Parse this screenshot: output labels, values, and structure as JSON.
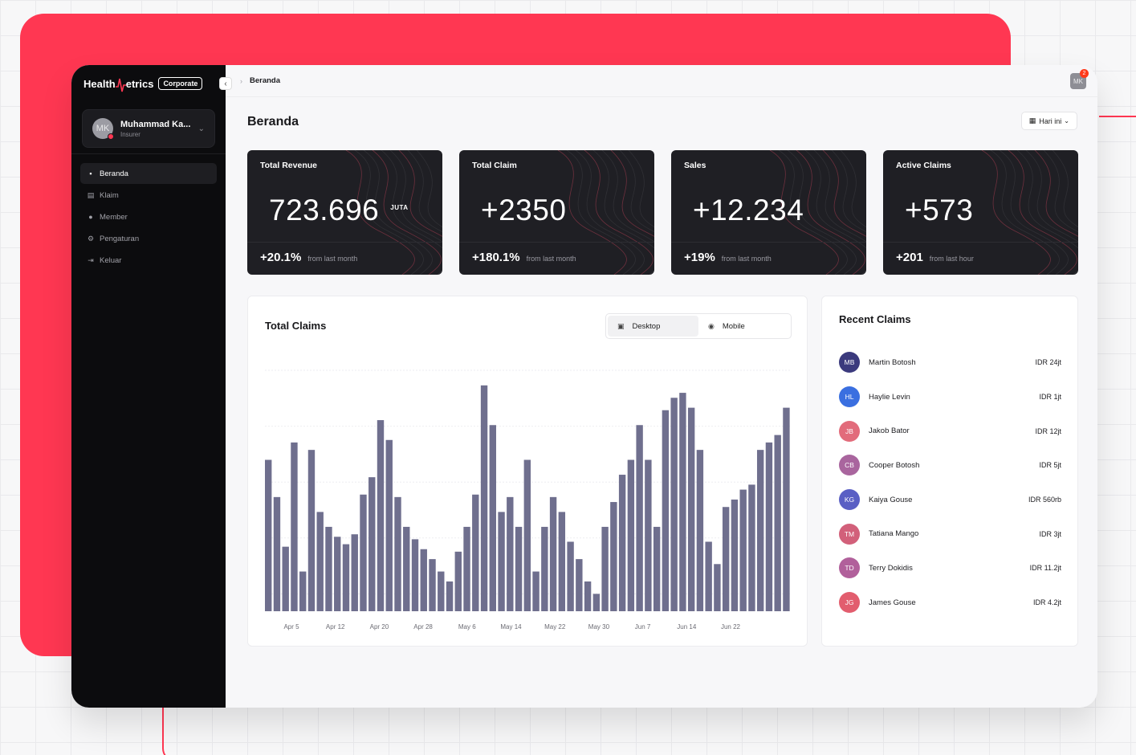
{
  "brand": {
    "name_part1": "Health",
    "name_part2": "etrics",
    "badge": "Corporate"
  },
  "user": {
    "initials": "MK",
    "name": "Muhammad Ka...",
    "role": "Insurer"
  },
  "nav": [
    {
      "label": "Beranda",
      "icon": "dashboard-icon",
      "active": true
    },
    {
      "label": "Klaim",
      "icon": "receipt-icon",
      "active": false
    },
    {
      "label": "Member",
      "icon": "user-icon",
      "active": false
    },
    {
      "label": "Pengaturan",
      "icon": "gear-icon",
      "active": false
    },
    {
      "label": "Keluar",
      "icon": "logout-icon",
      "active": false
    }
  ],
  "breadcrumb": {
    "current": "Beranda"
  },
  "topbar": {
    "avatar_initials": "MK",
    "notification_count": "2"
  },
  "page": {
    "title": "Beranda",
    "date_filter": "Hari ini"
  },
  "stats": [
    {
      "label": "Total Revenue",
      "value": "723.696",
      "unit": "JUTA",
      "change": "+20.1%",
      "note": "from last month"
    },
    {
      "label": "Total Claim",
      "value": "+2350",
      "unit": "",
      "change": "+180.1%",
      "note": "from last month"
    },
    {
      "label": "Sales",
      "value": "+12.234",
      "unit": "",
      "change": "+19%",
      "note": "from last month"
    },
    {
      "label": "Active Claims",
      "value": "+573",
      "unit": "",
      "change": "+201",
      "note": "from last hour"
    }
  ],
  "claims_panel": {
    "title": "Total Claims",
    "toggle": {
      "desktop": "Desktop",
      "mobile": "Mobile",
      "active": "Desktop"
    }
  },
  "chart_data": {
    "type": "bar",
    "title": "Total Claims",
    "series_color": "#6f6f8e",
    "x_tick_labels": [
      "Apr 5",
      "Apr 12",
      "Apr 20",
      "Apr 28",
      "May 6",
      "May 14",
      "May 22",
      "May 30",
      "Jun 7",
      "Jun 14",
      "Jun 22"
    ],
    "values": [
      61,
      46,
      26,
      68,
      16,
      65,
      40,
      34,
      30,
      27,
      31,
      47,
      54,
      77,
      69,
      46,
      34,
      29,
      25,
      21,
      16,
      12,
      24,
      34,
      47,
      91,
      75,
      40,
      46,
      34,
      61,
      16,
      34,
      46,
      40,
      28,
      21,
      12,
      7,
      34,
      44,
      55,
      61,
      75,
      61,
      34,
      81,
      86,
      88,
      82,
      65,
      28,
      19,
      42,
      45,
      49,
      51,
      65,
      68,
      71,
      82
    ],
    "ylim": [
      0,
      100
    ],
    "grid": true,
    "legend": "none"
  },
  "recent_claims": {
    "title": "Recent Claims",
    "items": [
      {
        "initials": "MB",
        "name": "Martin Botosh",
        "amount": "IDR 24jt",
        "color": "#3b3a7d"
      },
      {
        "initials": "HL",
        "name": "Haylie Levin",
        "amount": "IDR 1jt",
        "color": "#3a6fe0"
      },
      {
        "initials": "JB",
        "name": "Jakob Bator",
        "amount": "IDR 12jt",
        "color": "#e26b7b"
      },
      {
        "initials": "CB",
        "name": "Cooper Botosh",
        "amount": "IDR 5jt",
        "color": "#a9659e"
      },
      {
        "initials": "KG",
        "name": "Kaiya Gouse",
        "amount": "IDR 560rb",
        "color": "#5a5fc4"
      },
      {
        "initials": "TM",
        "name": "Tatiana Mango",
        "amount": "IDR 3jt",
        "color": "#d2607a"
      },
      {
        "initials": "TD",
        "name": "Terry Dokidis",
        "amount": "IDR 11.2jt",
        "color": "#b1609b"
      },
      {
        "initials": "JG",
        "name": "James Gouse",
        "amount": "IDR 4.2jt",
        "color": "#e25d6e"
      }
    ]
  }
}
